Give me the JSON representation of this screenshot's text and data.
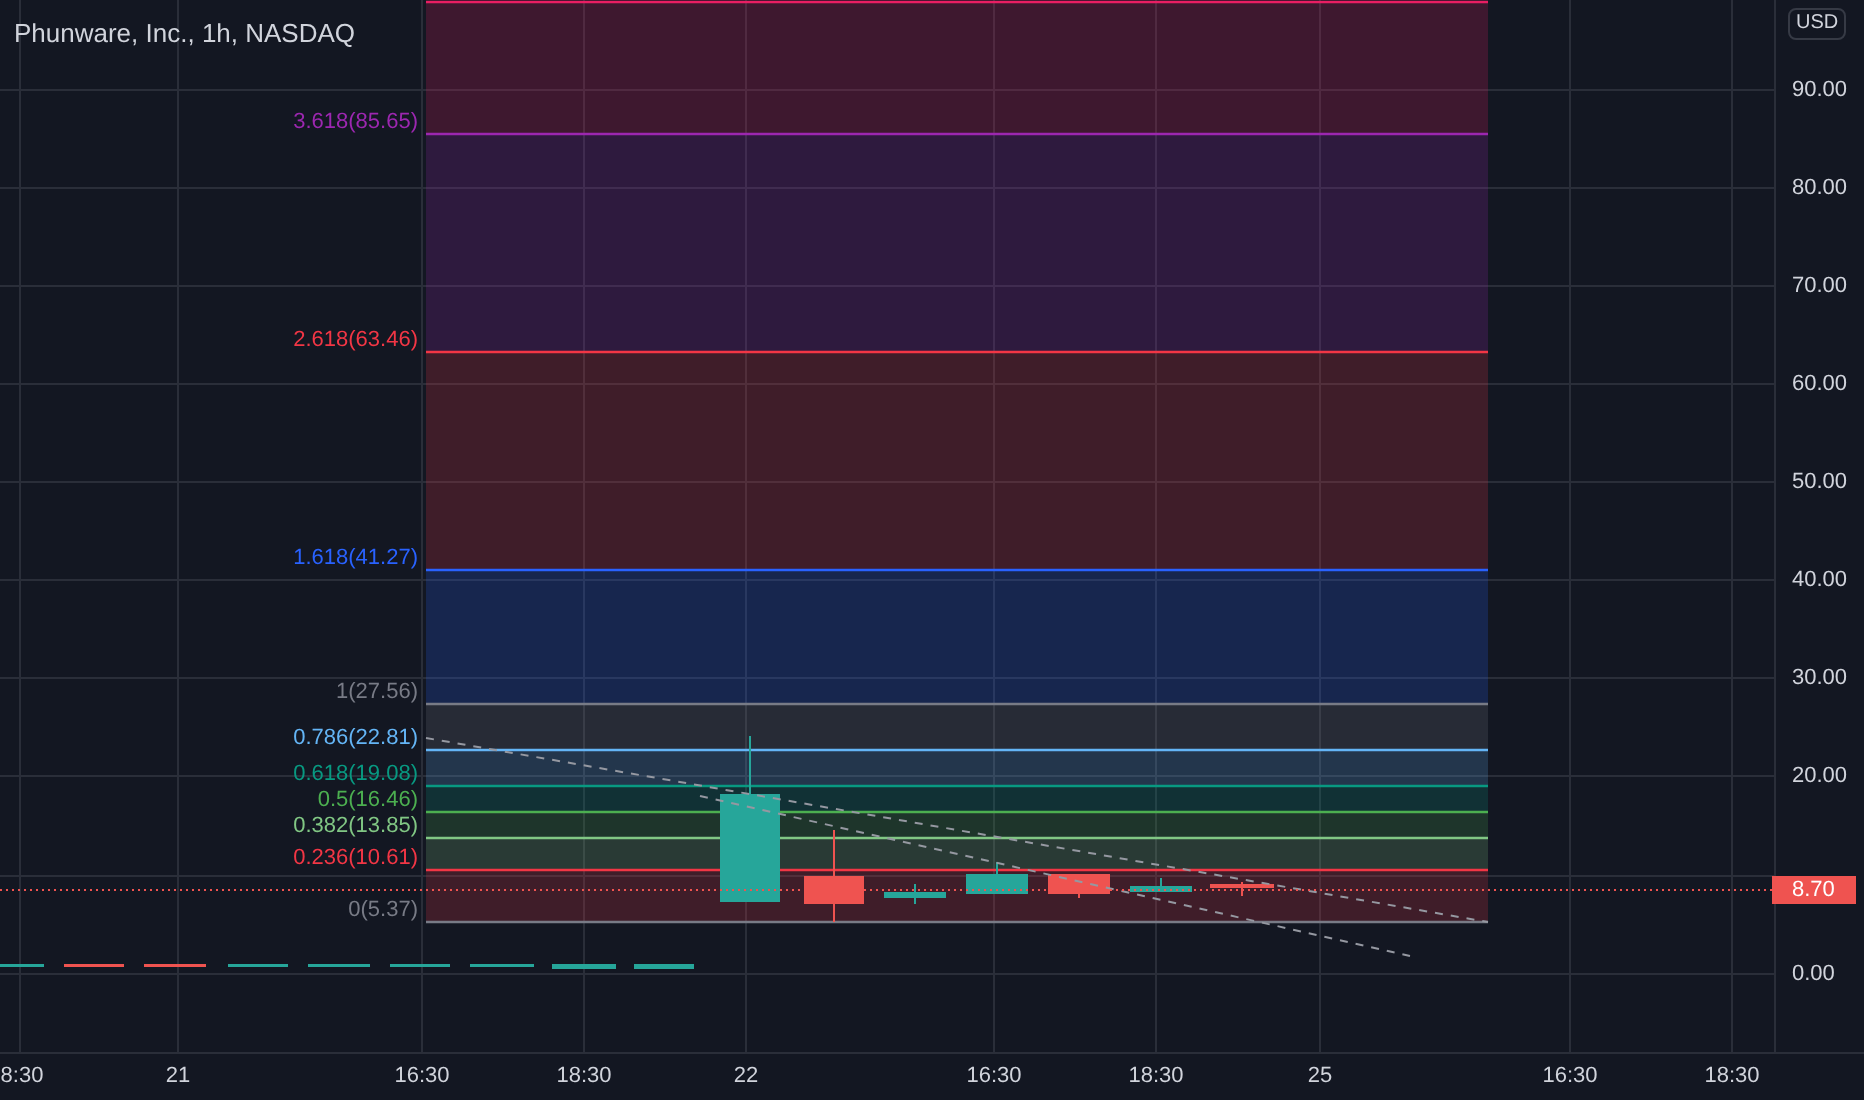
{
  "title": "Phunware, Inc., 1h, NASDAQ",
  "currency": "USD",
  "price_axis": [
    "90.00",
    "80.00",
    "70.00",
    "60.00",
    "50.00",
    "40.00",
    "30.00",
    "20.00",
    "0.00"
  ],
  "last_price": "8.70",
  "time_axis": [
    "8:30",
    "21",
    "16:30",
    "18:30",
    "22",
    "16:30",
    "18:30",
    "25",
    "16:30",
    "18:30"
  ],
  "fib_levels": [
    {
      "label": "3.618(85.65)",
      "color": "#9c27b0"
    },
    {
      "label": "2.618(63.46)",
      "color": "#f23645"
    },
    {
      "label": "1.618(41.27)",
      "color": "#2962ff"
    },
    {
      "label": "1(27.56)",
      "color": "#787b86"
    },
    {
      "label": "0.786(22.81)",
      "color": "#64b5f6"
    },
    {
      "label": "0.618(19.08)",
      "color": "#089981"
    },
    {
      "label": "0.5(16.46)",
      "color": "#4caf50"
    },
    {
      "label": "0.382(13.85)",
      "color": "#81c784"
    },
    {
      "label": "0.236(10.61)",
      "color": "#f23645"
    },
    {
      "label": "0(5.37)",
      "color": "#787b86"
    }
  ]
}
